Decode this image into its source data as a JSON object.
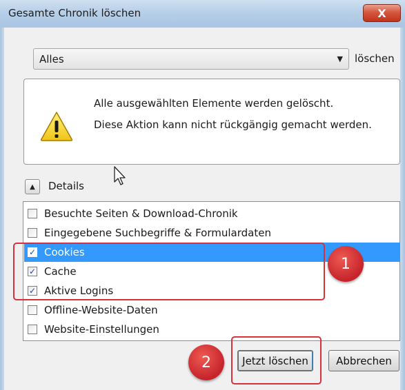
{
  "window": {
    "title": "Gesamte Chronik löschen",
    "close_label": "X"
  },
  "range": {
    "selected": "Alles",
    "suffix": "löschen"
  },
  "warning": {
    "line1": "Alle ausgewählten Elemente werden gelöscht.",
    "line2": "Diese Aktion kann nicht rückgängig gemacht werden.",
    "icon": "warning-triangle-icon"
  },
  "details": {
    "label": "Details",
    "expanded": true
  },
  "items": [
    {
      "label": "Besuchte Seiten & Download-Chronik",
      "checked": false,
      "selected": false
    },
    {
      "label": "Eingegebene Suchbegriffe & Formulardaten",
      "checked": false,
      "selected": false
    },
    {
      "label": "Cookies",
      "checked": true,
      "selected": true
    },
    {
      "label": "Cache",
      "checked": true,
      "selected": false
    },
    {
      "label": "Aktive Logins",
      "checked": true,
      "selected": false
    },
    {
      "label": "Offline-Website-Daten",
      "checked": false,
      "selected": false
    },
    {
      "label": "Website-Einstellungen",
      "checked": false,
      "selected": false
    }
  ],
  "buttons": {
    "clear_now": "Jetzt löschen",
    "cancel": "Abbrechen"
  },
  "annotations": {
    "badge1": "1",
    "badge2": "2",
    "color": "#d8313c"
  }
}
